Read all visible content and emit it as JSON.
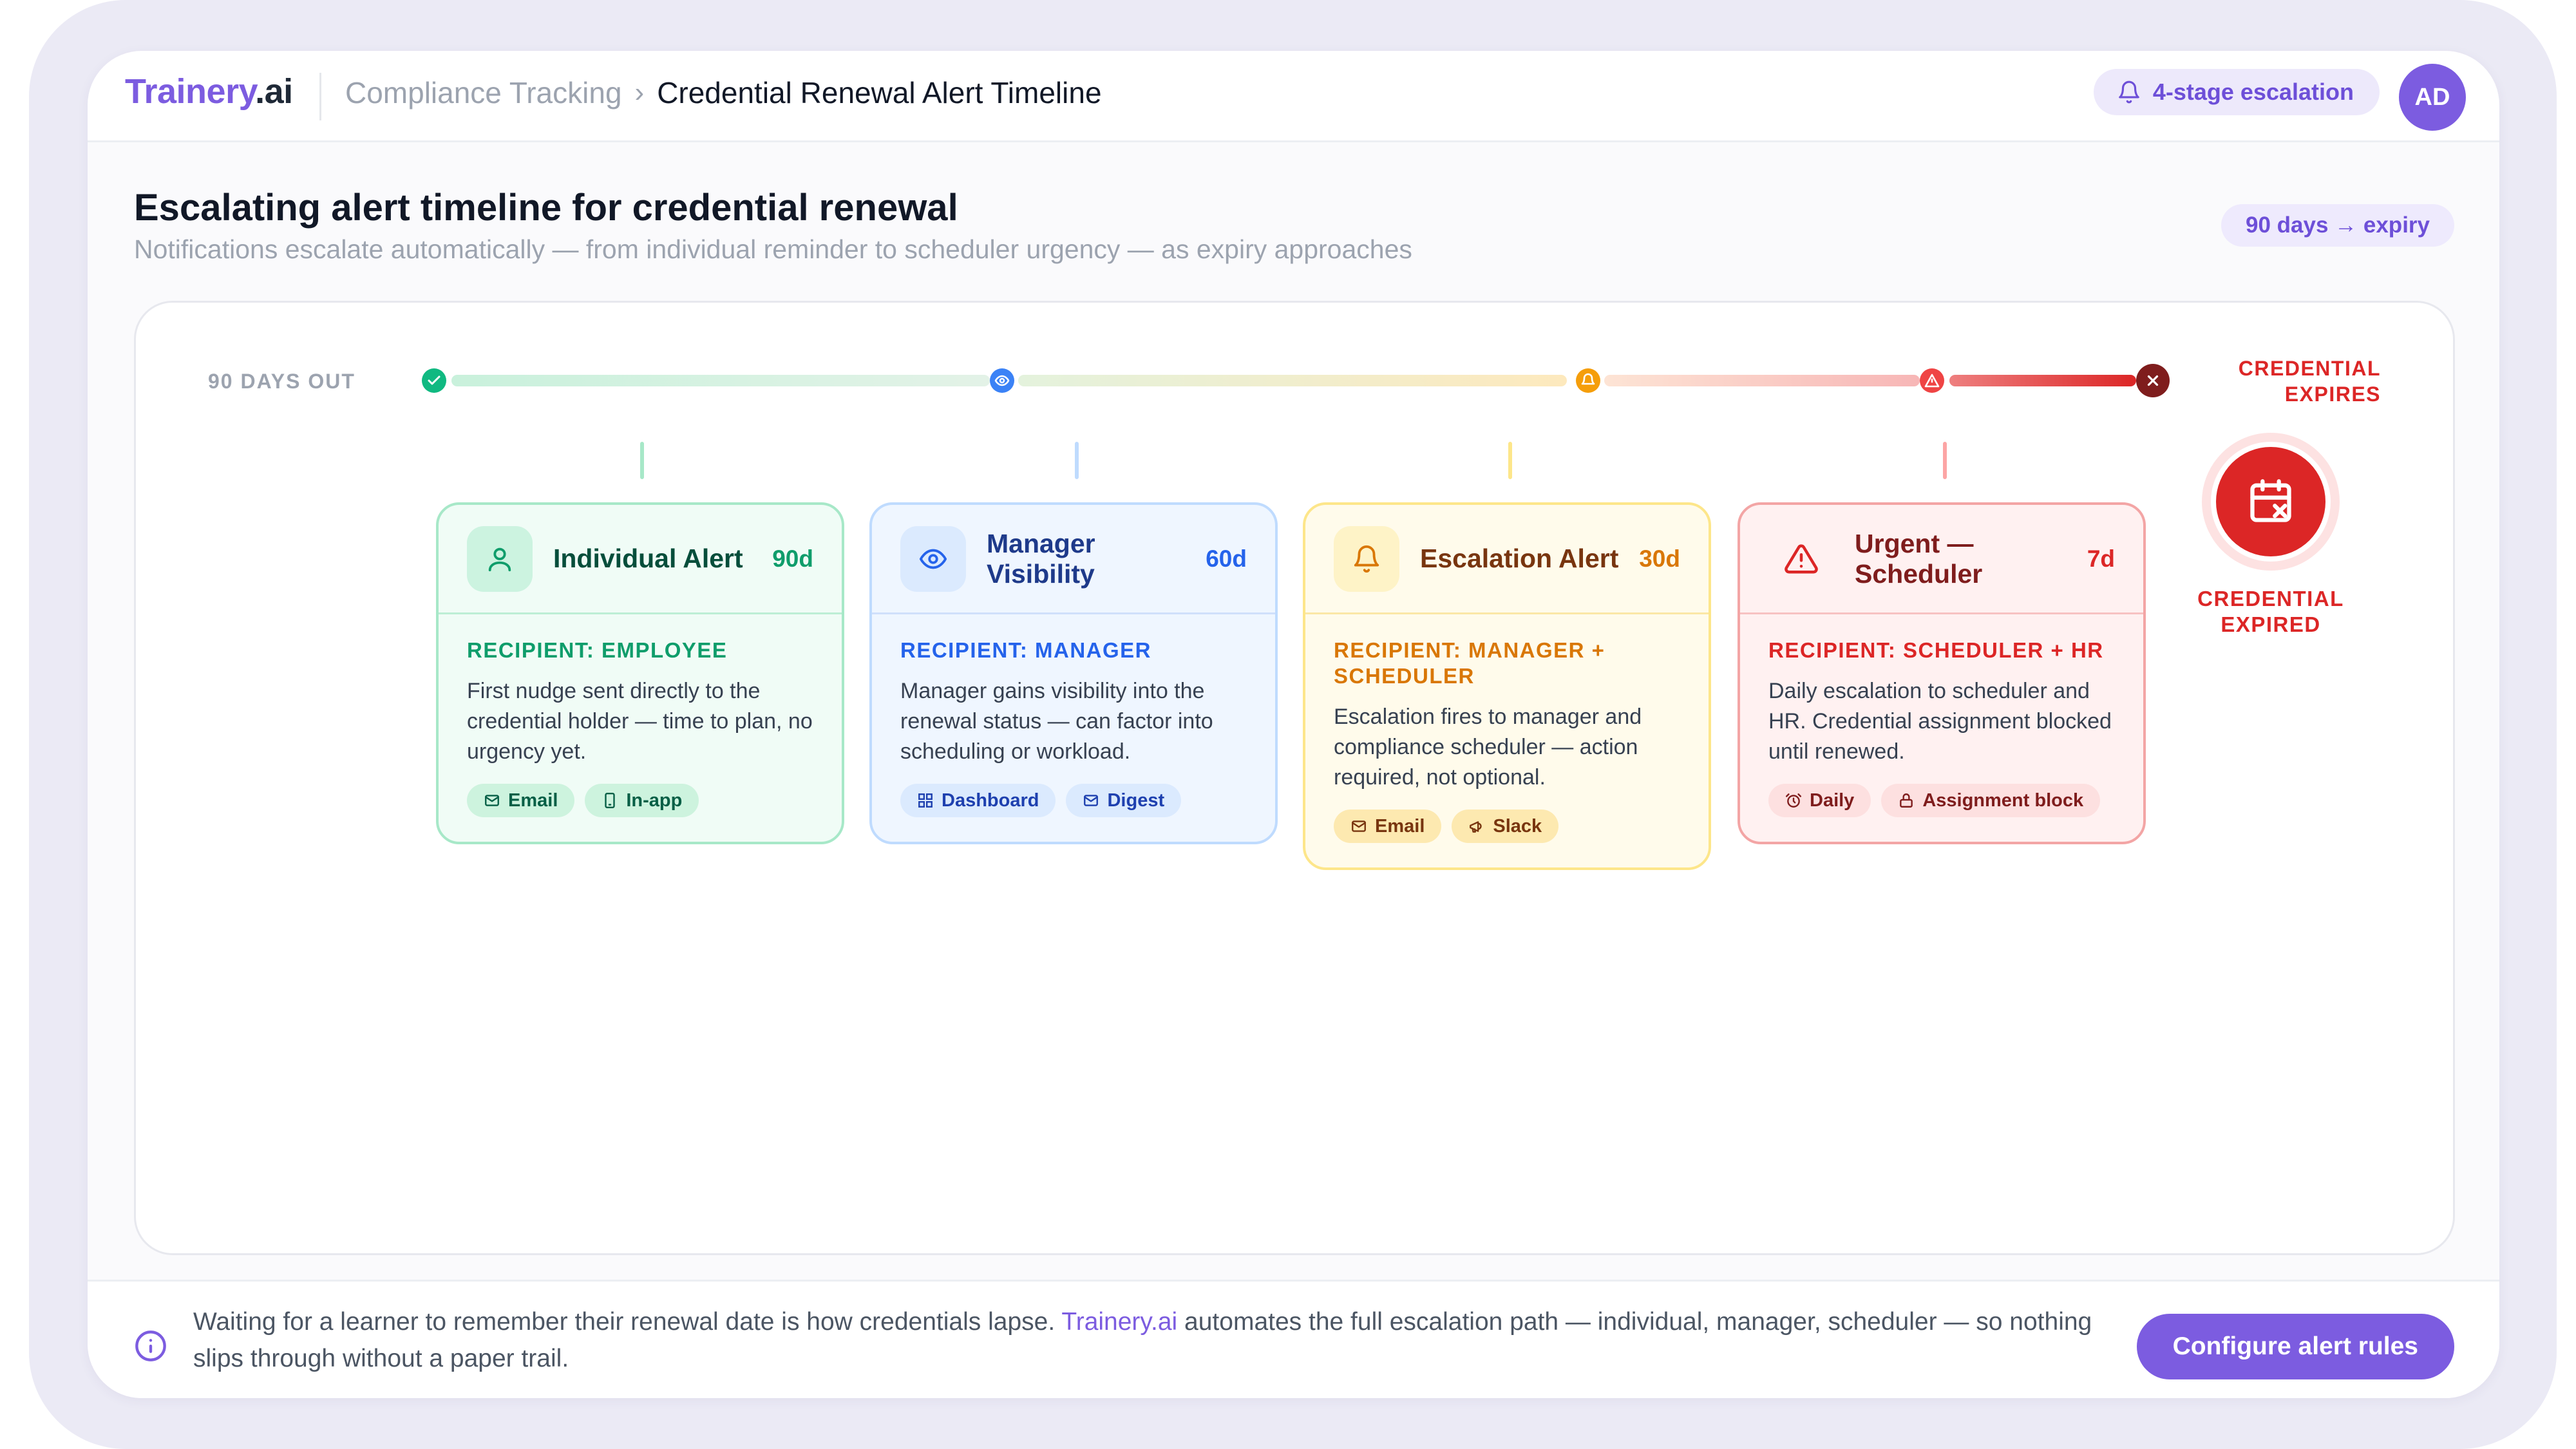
{
  "header": {
    "logo_main": "Trainery",
    "logo_suffix": ".ai",
    "breadcrumb_parent": "Compliance Tracking",
    "breadcrumb_separator": "›",
    "breadcrumb_current": "Credential Renewal Alert Timeline",
    "escalation_pill": "4-stage escalation",
    "avatar_initials": "AD"
  },
  "page": {
    "title": "Escalating alert timeline for credential renewal",
    "subtitle": "Notifications escalate automatically — from individual reminder to scheduler urgency — as expiry approaches",
    "range_pill": "90 days → expiry"
  },
  "timeline": {
    "start_label": "90 DAYS OUT",
    "end_label_line1": "CREDENTIAL",
    "end_label_line2": "EXPIRES",
    "expired_line1": "CREDENTIAL",
    "expired_line2": "EXPIRED"
  },
  "stages": [
    {
      "title": "Individual Alert",
      "days": "90d",
      "recipient": "RECIPIENT: EMPLOYEE",
      "description": "First nudge sent directly to the credential holder — time to plan, no urgency yet.",
      "tags": [
        "Email",
        "In-app"
      ],
      "color": "#0f9d6b"
    },
    {
      "title": "Manager Visibility",
      "days": "60d",
      "recipient": "RECIPIENT: MANAGER",
      "description": "Manager gains visibility into the renewal status — can factor into scheduling or workload.",
      "tags": [
        "Dashboard",
        "Digest"
      ],
      "color": "#2563eb"
    },
    {
      "title": "Escalation Alert",
      "days": "30d",
      "recipient": "RECIPIENT: MANAGER + SCHEDULER",
      "description": "Escalation fires to manager and compliance scheduler — action required, not optional.",
      "tags": [
        "Email",
        "Slack"
      ],
      "color": "#d97706"
    },
    {
      "title": "Urgent — Scheduler",
      "days": "7d",
      "recipient": "RECIPIENT: SCHEDULER + HR",
      "description": "Daily escalation to scheduler and HR. Credential assignment blocked until renewed.",
      "tags": [
        "Daily",
        "Assignment block"
      ],
      "color": "#dc2626"
    }
  ],
  "footer": {
    "text_before": "Waiting for a learner to remember their renewal date is how credentials lapse. ",
    "brand": "Trainery.ai",
    "text_after": " automates the full escalation path — individual, manager, scheduler — so nothing slips through without a paper trail.",
    "cta": "Configure alert rules"
  }
}
